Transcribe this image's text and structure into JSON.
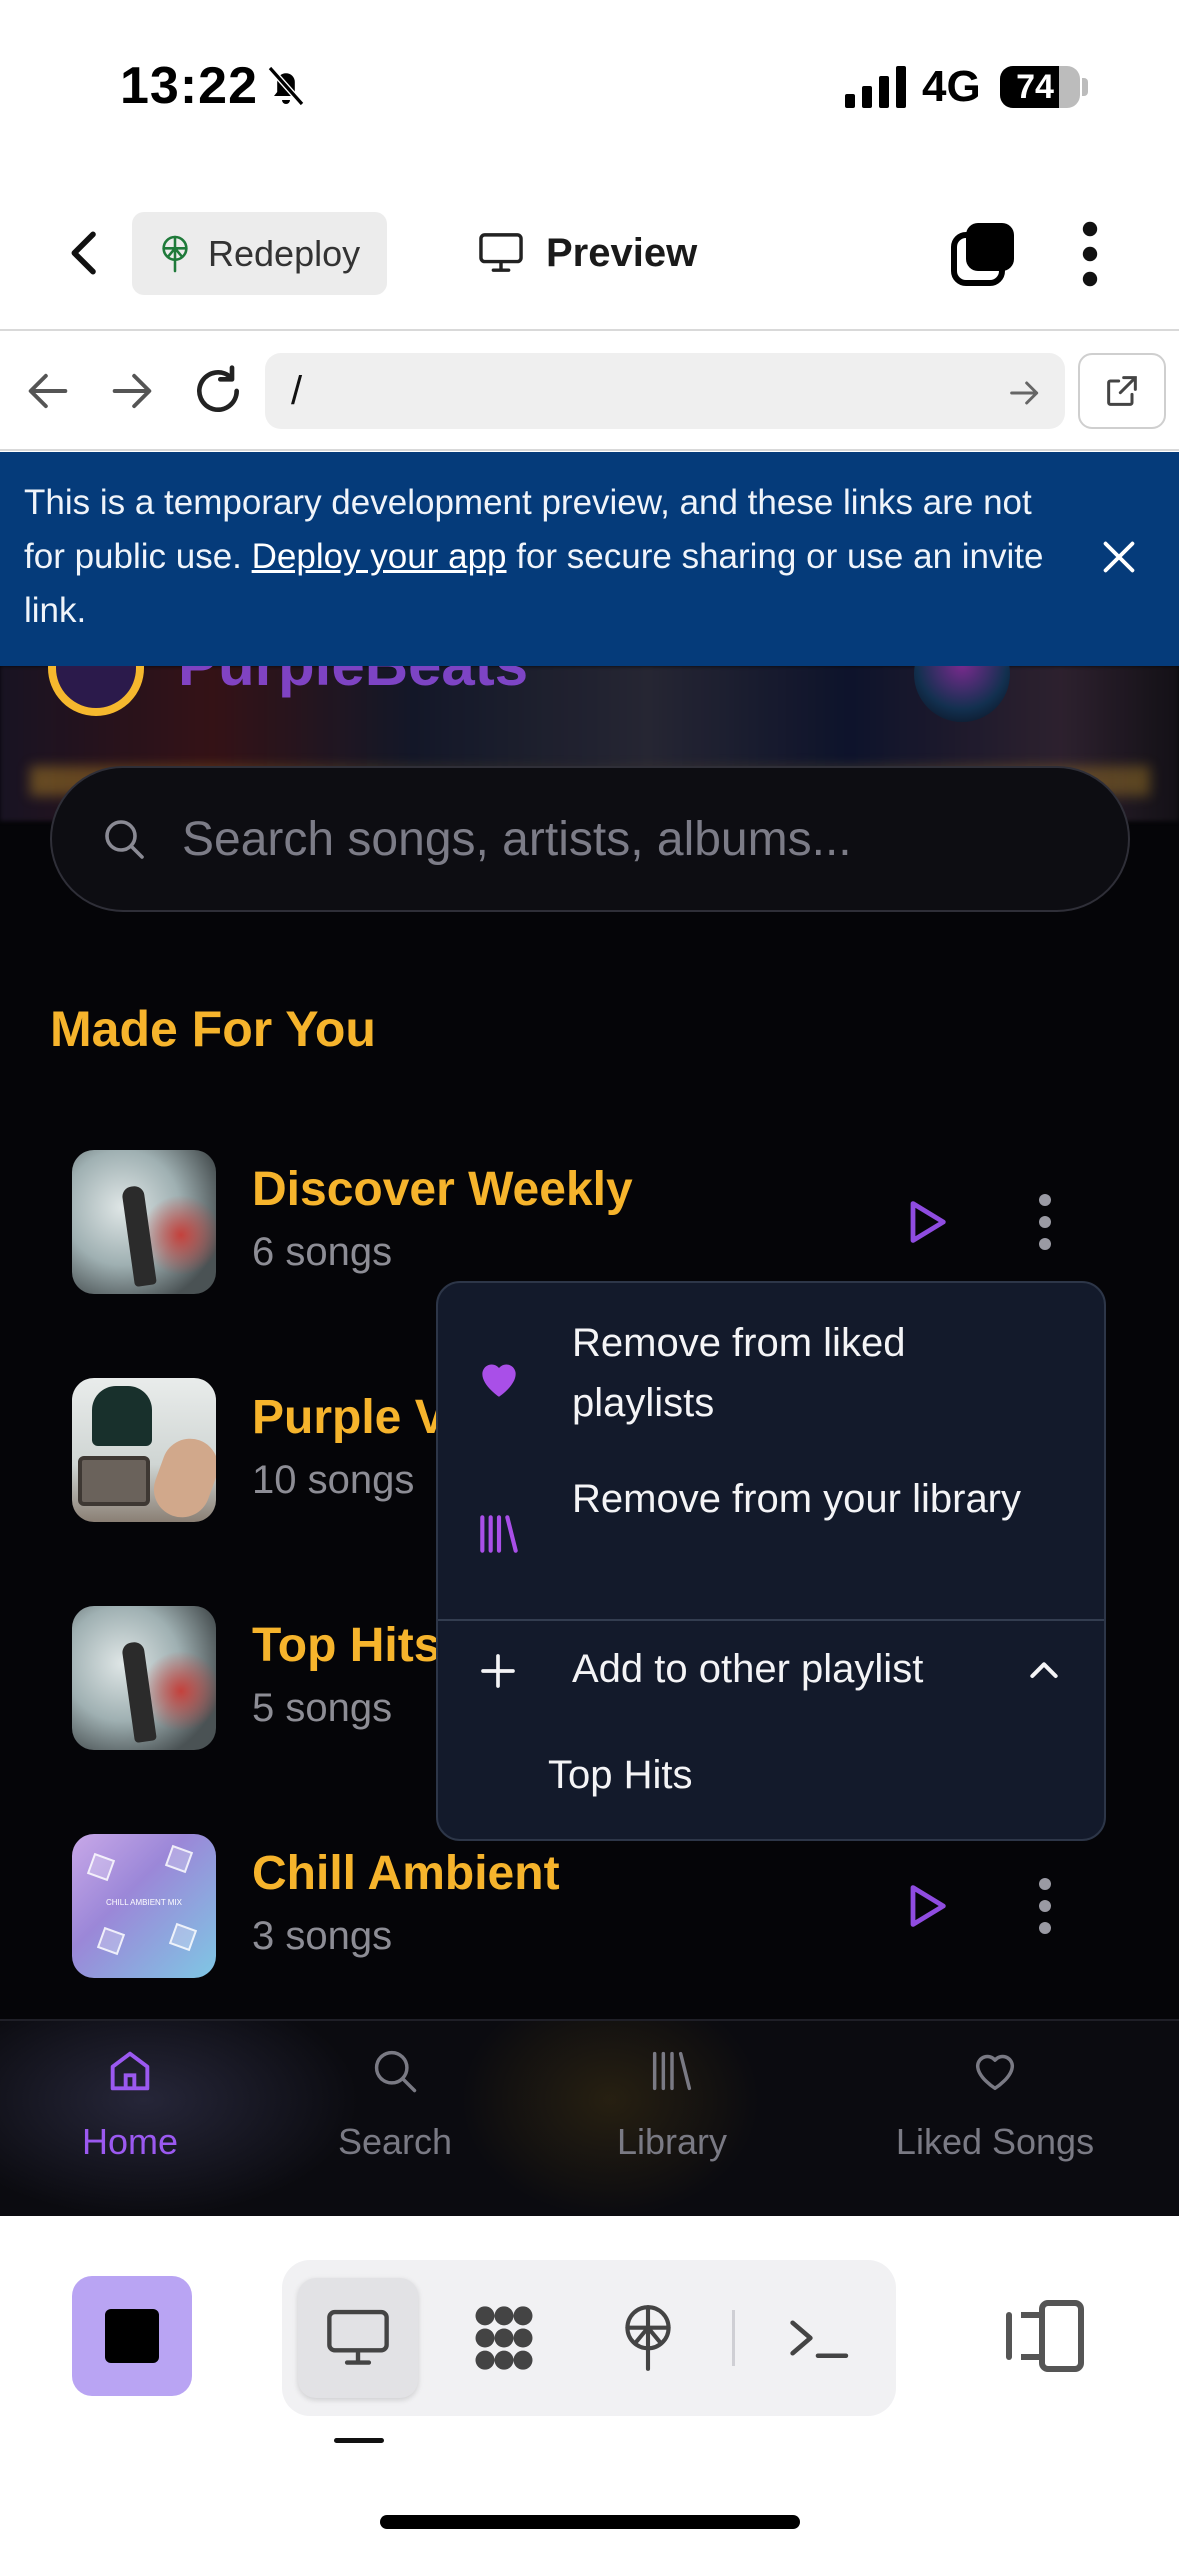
{
  "status_bar": {
    "time": "13:22",
    "network": "4G",
    "battery": "74",
    "battery_level": 0.74
  },
  "toolbar": {
    "redeploy_label": "Redeploy",
    "preview_label": "Preview"
  },
  "browser": {
    "url": "/"
  },
  "banner": {
    "text_before": "This is a temporary development preview, and these links are not for public use. ",
    "link_text": "Deploy your app",
    "text_after": " for secure sharing or use an invite link."
  },
  "app": {
    "brand": "PurpleBeats",
    "search_placeholder": "Search songs, artists, albums...",
    "section_title": "Made For You",
    "playlists": [
      {
        "name": "Discover Weekly",
        "count": "6 songs"
      },
      {
        "name": "Purple Vibes",
        "count": "10 songs"
      },
      {
        "name": "Top Hits",
        "count": "5 songs"
      },
      {
        "name": "Chill Ambient",
        "count": "3 songs"
      }
    ],
    "thumb_text": "CHILL AMBIENT MIX"
  },
  "context_menu": {
    "items": [
      {
        "label": "Remove from liked playlists",
        "icon": "heart-icon"
      },
      {
        "label": "Remove from your library",
        "icon": "library-icon"
      },
      {
        "label": "Add to other playlist",
        "icon": "plus-icon"
      }
    ],
    "sub_items": [
      "Top Hits"
    ]
  },
  "bottom_nav": {
    "tabs": [
      {
        "label": "Home",
        "icon": "home-icon",
        "active": true
      },
      {
        "label": "Search",
        "icon": "search-icon",
        "active": false
      },
      {
        "label": "Library",
        "icon": "library-icon",
        "active": false
      },
      {
        "label": "Liked Songs",
        "icon": "heart-icon",
        "active": false
      }
    ]
  },
  "colors": {
    "accent_gold": "#f6b42c",
    "accent_purple": "#9b59f0",
    "banner_blue": "#053b7a",
    "app_bg": "#050508"
  }
}
